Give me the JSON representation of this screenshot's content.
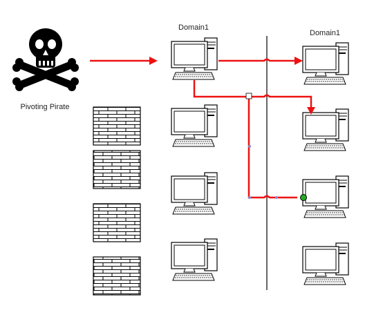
{
  "labels": {
    "attacker": "Pivoting Pirate",
    "domain_left": "Domain1",
    "domain_right": "Domain1"
  },
  "colors": {
    "attack_path": "#ee1111",
    "network_bus": "#000000",
    "firewall_brick": "#000000",
    "connector_point": "#22aa22"
  },
  "icons": {
    "attacker": "skull-and-crossbones-icon",
    "host": "desktop-computer-icon",
    "firewall": "brick-wall-icon"
  }
}
